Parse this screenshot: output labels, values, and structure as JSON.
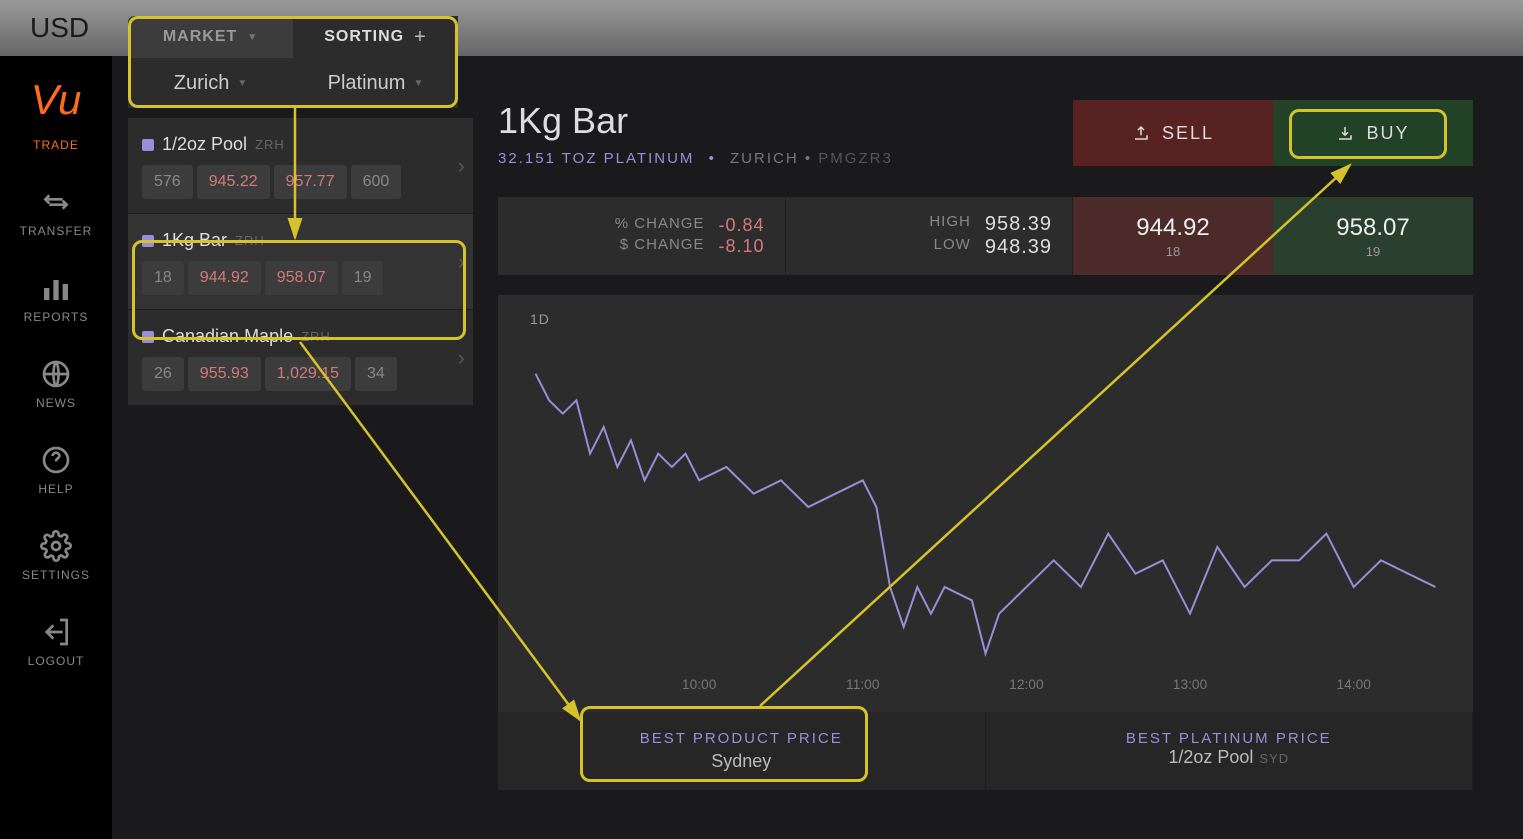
{
  "topbar": {
    "currency": "USD"
  },
  "tabs": {
    "market": "MARKET",
    "sorting": "SORTING"
  },
  "filters": {
    "location": "Zurich",
    "metal": "Platinum"
  },
  "nav": {
    "trade": "TRADE",
    "transfer": "TRANSFER",
    "reports": "REPORTS",
    "news": "NEWS",
    "help": "HELP",
    "settings": "SETTINGS",
    "logout": "LOGOUT"
  },
  "products": [
    {
      "name": "1/2oz Pool",
      "loc": "ZRH",
      "q1": "576",
      "sell": "945.22",
      "buy": "957.77",
      "q2": "600"
    },
    {
      "name": "1Kg Bar",
      "loc": "ZRH",
      "q1": "18",
      "sell": "944.92",
      "buy": "958.07",
      "q2": "19"
    },
    {
      "name": "Canadian Maple",
      "loc": "ZRH",
      "q1": "26",
      "sell": "955.93",
      "buy": "1,029.15",
      "q2": "34"
    }
  ],
  "detail": {
    "title": "1Kg Bar",
    "sub_metal": "32.151 TOZ PLATINUM",
    "sub_loc": "ZURICH",
    "sub_code": "PMGZR3",
    "sell_label": "SELL",
    "buy_label": "BUY",
    "pct_change_lbl": "% CHANGE",
    "pct_change": "-0.84",
    "dollar_change_lbl": "$ CHANGE",
    "dollar_change": "-8.10",
    "high_lbl": "HIGH",
    "high": "958.39",
    "low_lbl": "LOW",
    "low": "948.39",
    "sell_price": "944.92",
    "sell_qty": "18",
    "buy_price": "958.07",
    "buy_qty": "19",
    "period": "1D",
    "best_product_lbl": "BEST PRODUCT PRICE",
    "best_product_val": "Sydney",
    "best_metal_lbl": "BEST PLATINUM PRICE",
    "best_metal_val": "1/2oz Pool",
    "best_metal_loc": "SYD"
  },
  "chart_data": {
    "type": "line",
    "title": "1D",
    "xlabel": "",
    "ylabel": "",
    "x_ticks": [
      "10:00",
      "11:00",
      "12:00",
      "13:00",
      "14:00"
    ],
    "ylim": [
      948,
      960
    ],
    "series": [
      {
        "name": "price",
        "color": "#9b8dd8",
        "values": [
          {
            "t": "09:00",
            "v": 959
          },
          {
            "t": "09:05",
            "v": 958
          },
          {
            "t": "09:10",
            "v": 957.5
          },
          {
            "t": "09:15",
            "v": 958
          },
          {
            "t": "09:20",
            "v": 956
          },
          {
            "t": "09:25",
            "v": 957
          },
          {
            "t": "09:30",
            "v": 955.5
          },
          {
            "t": "09:35",
            "v": 956.5
          },
          {
            "t": "09:40",
            "v": 955
          },
          {
            "t": "09:45",
            "v": 956
          },
          {
            "t": "09:50",
            "v": 955.5
          },
          {
            "t": "09:55",
            "v": 956
          },
          {
            "t": "10:00",
            "v": 955
          },
          {
            "t": "10:10",
            "v": 955.5
          },
          {
            "t": "10:20",
            "v": 954.5
          },
          {
            "t": "10:30",
            "v": 955
          },
          {
            "t": "10:40",
            "v": 954
          },
          {
            "t": "10:50",
            "v": 954.5
          },
          {
            "t": "11:00",
            "v": 955
          },
          {
            "t": "11:05",
            "v": 954
          },
          {
            "t": "11:10",
            "v": 951
          },
          {
            "t": "11:15",
            "v": 949.5
          },
          {
            "t": "11:20",
            "v": 951
          },
          {
            "t": "11:25",
            "v": 950
          },
          {
            "t": "11:30",
            "v": 951
          },
          {
            "t": "11:40",
            "v": 950.5
          },
          {
            "t": "11:45",
            "v": 948.5
          },
          {
            "t": "11:50",
            "v": 950
          },
          {
            "t": "12:00",
            "v": 951
          },
          {
            "t": "12:10",
            "v": 952
          },
          {
            "t": "12:20",
            "v": 951
          },
          {
            "t": "12:30",
            "v": 953
          },
          {
            "t": "12:40",
            "v": 951.5
          },
          {
            "t": "12:50",
            "v": 952
          },
          {
            "t": "13:00",
            "v": 950
          },
          {
            "t": "13:10",
            "v": 952.5
          },
          {
            "t": "13:20",
            "v": 951
          },
          {
            "t": "13:30",
            "v": 952
          },
          {
            "t": "13:40",
            "v": 952
          },
          {
            "t": "13:50",
            "v": 953
          },
          {
            "t": "14:00",
            "v": 951
          },
          {
            "t": "14:10",
            "v": 952
          },
          {
            "t": "14:20",
            "v": 951.5
          },
          {
            "t": "14:30",
            "v": 951
          }
        ]
      }
    ]
  }
}
